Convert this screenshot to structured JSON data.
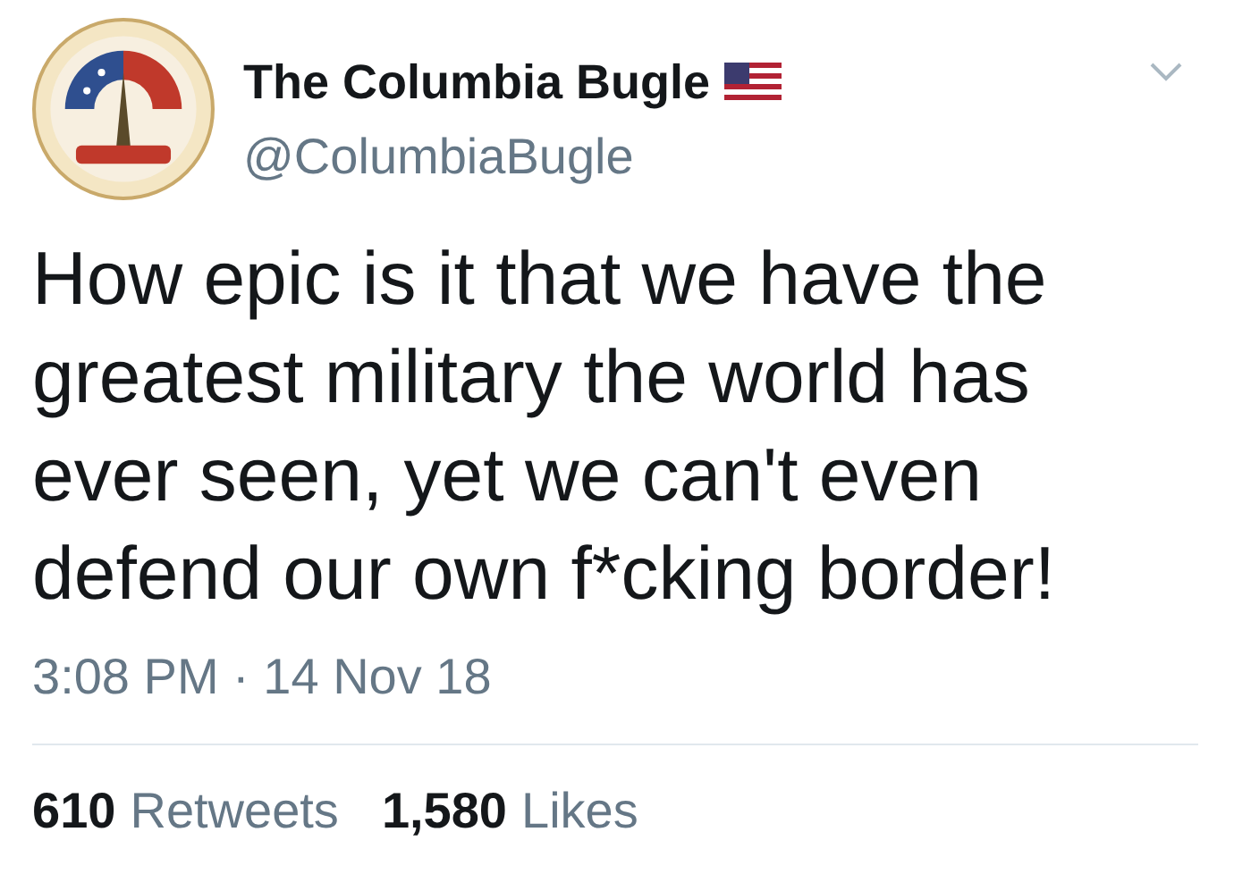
{
  "author": {
    "name": "The Columbia Bugle",
    "handle": "@ColumbiaBugle",
    "verified_flag": true
  },
  "tweet": {
    "text": "How epic is it that we have the greatest military the world has ever seen, yet we can't even defend our own f*cking border!",
    "timestamp": "3:08 PM · 14 Nov 18"
  },
  "stats": [
    {
      "count": "610",
      "label": "Retweets"
    },
    {
      "count": "1,580",
      "label": "Likes"
    }
  ]
}
